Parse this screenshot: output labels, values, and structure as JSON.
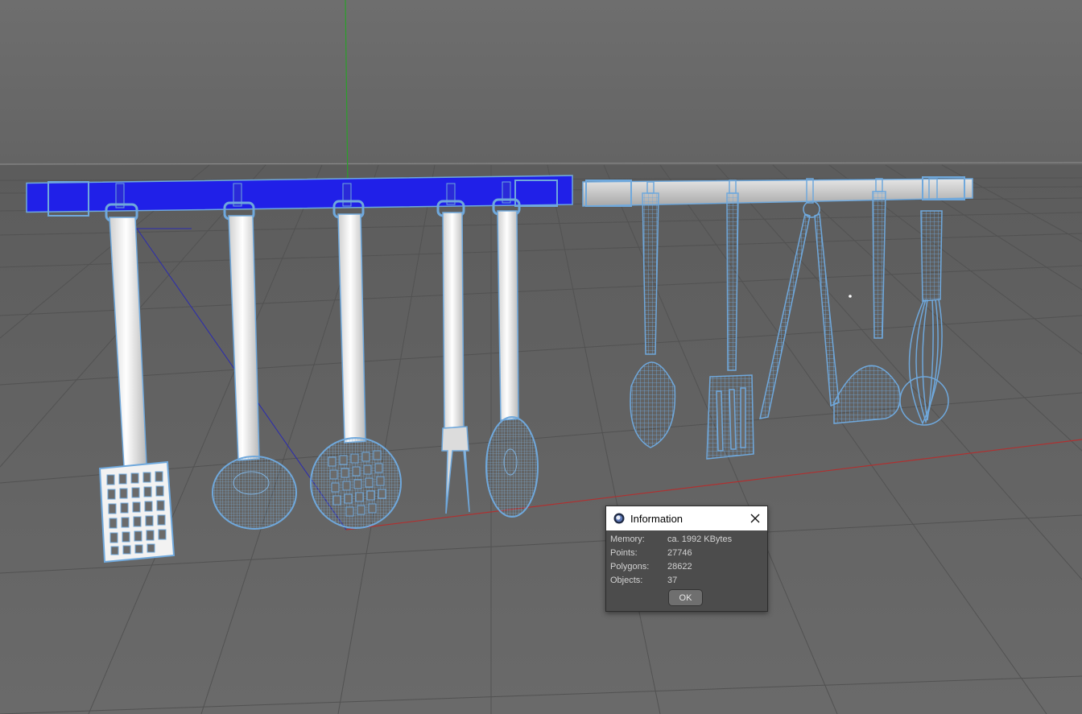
{
  "dialog": {
    "title": "Information",
    "app_icon": "cinema4d-logo-icon",
    "close_icon": "close-icon",
    "rows": [
      {
        "label": "Memory:",
        "value": "ca. 1992 KBytes"
      },
      {
        "label": "Points:",
        "value": "27746"
      },
      {
        "label": "Polygons:",
        "value": "28622"
      },
      {
        "label": "Objects:",
        "value": "37"
      }
    ],
    "ok_label": "OK"
  },
  "colors": {
    "viewport_background": "#6b6b6b",
    "grid_line": "#595959",
    "x_axis": "#b03030",
    "y_axis": "#2aa02a",
    "z_axis": "#2a2ab0",
    "selection_wire": "#6fa8dc",
    "selected_rail": "#2020e8",
    "dialog_background": "#4c4c4c"
  }
}
